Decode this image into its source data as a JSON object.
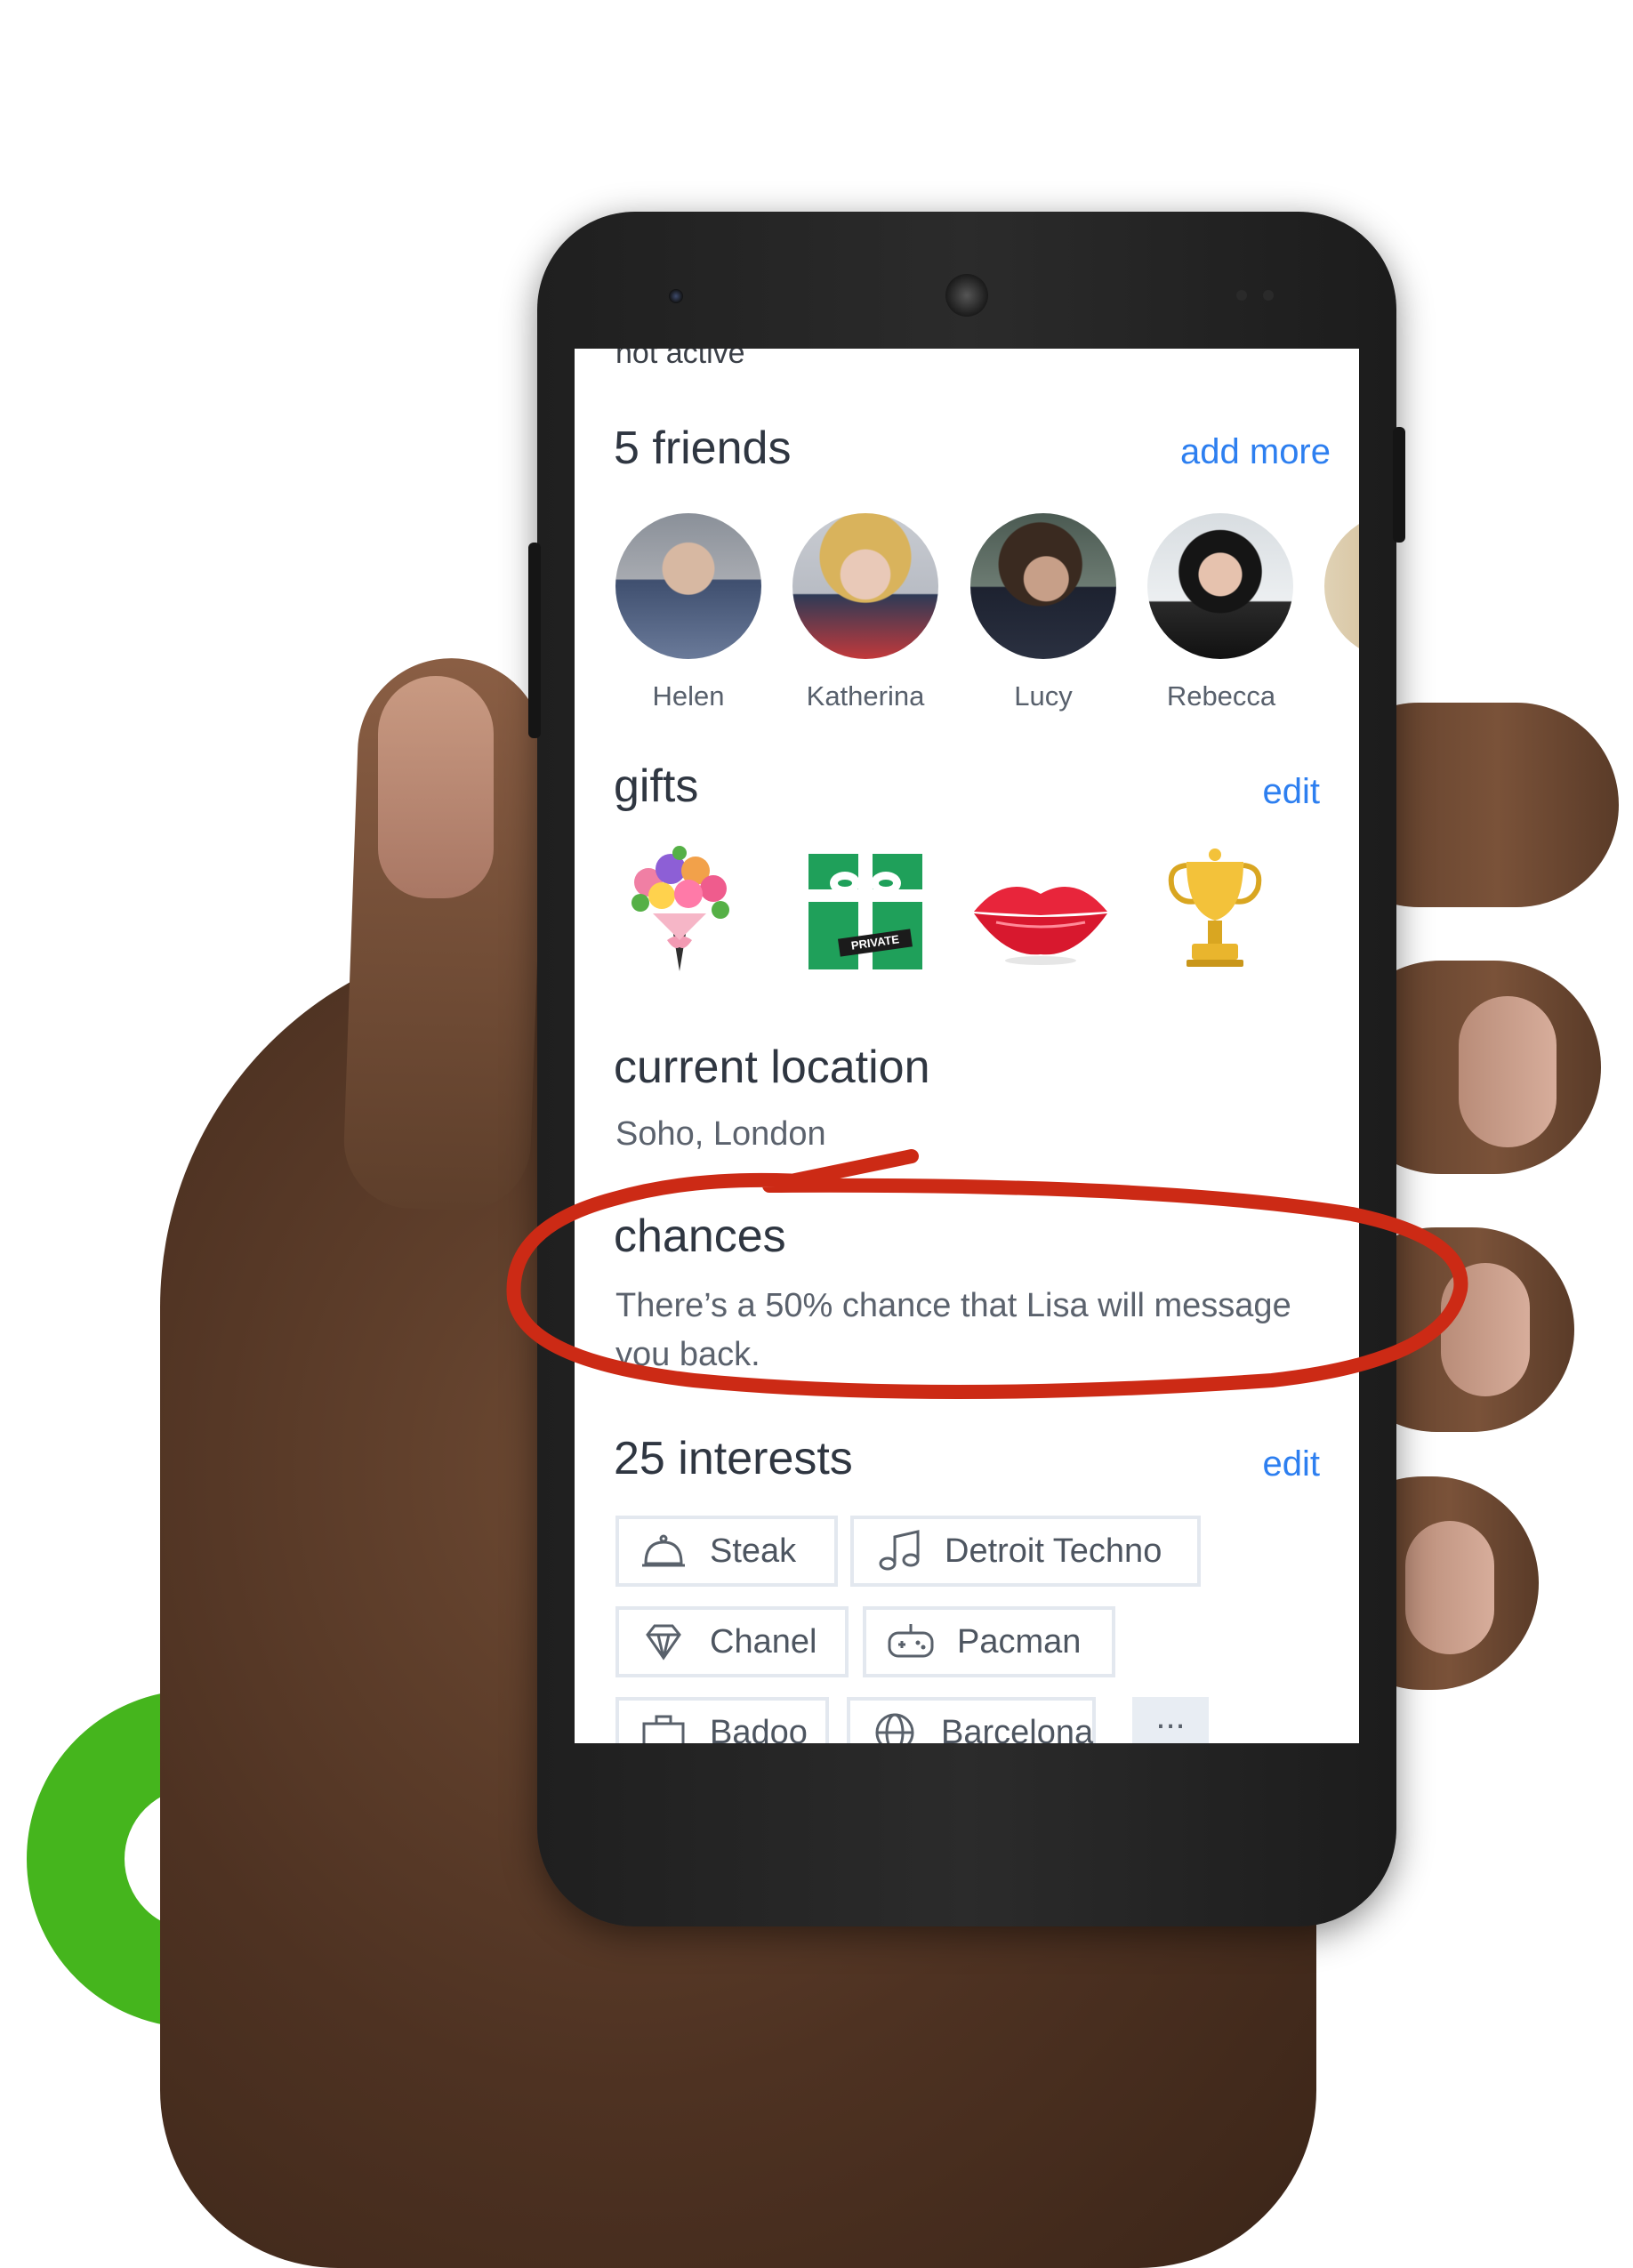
{
  "profile": {
    "cut_status": "not active",
    "friends": {
      "title": "5 friends",
      "action": "add more",
      "items": [
        {
          "name": "Helen",
          "colors": [
            "#8a9099",
            "#d7b8a2",
            "#3f4f6f"
          ]
        },
        {
          "name": "Katherina",
          "colors": [
            "#c9ccd2",
            "#e9c9b8",
            "#2e3a56"
          ]
        },
        {
          "name": "Lucy",
          "colors": [
            "#4b5a52",
            "#c79f88",
            "#1d2230"
          ]
        },
        {
          "name": "Rebecca",
          "colors": [
            "#d8dde1",
            "#e6c2ae",
            "#151515"
          ]
        }
      ]
    },
    "gifts": {
      "title": "gifts",
      "action": "edit",
      "items": [
        {
          "icon": "flower-bouquet-icon"
        },
        {
          "icon": "private-gift-box-icon",
          "label": "PRIVATE"
        },
        {
          "icon": "lips-icon"
        },
        {
          "icon": "gold-trophy-icon"
        }
      ]
    },
    "location": {
      "title": "current location",
      "value": "Soho, London"
    },
    "chances": {
      "title": "chances",
      "text_line1": "There’s a 50% chance that Lisa will message",
      "text_line2": "you back."
    },
    "interests": {
      "title": "25 interests",
      "action": "edit",
      "items": [
        {
          "label": "Steak",
          "icon": "cloche-icon"
        },
        {
          "label": "Detroit Techno",
          "icon": "music-note-icon"
        },
        {
          "label": "Chanel",
          "icon": "diamond-icon"
        },
        {
          "label": "Pacman",
          "icon": "gamepad-icon"
        },
        {
          "label": "Badoo",
          "icon": "briefcase-icon"
        },
        {
          "label": "Barcelona",
          "icon": "globe-icon"
        }
      ],
      "more_label": "..."
    }
  },
  "colors": {
    "accent_link": "#2d7ff0",
    "annotation_red": "#cc2a15",
    "brand_green": "#45b51d"
  }
}
